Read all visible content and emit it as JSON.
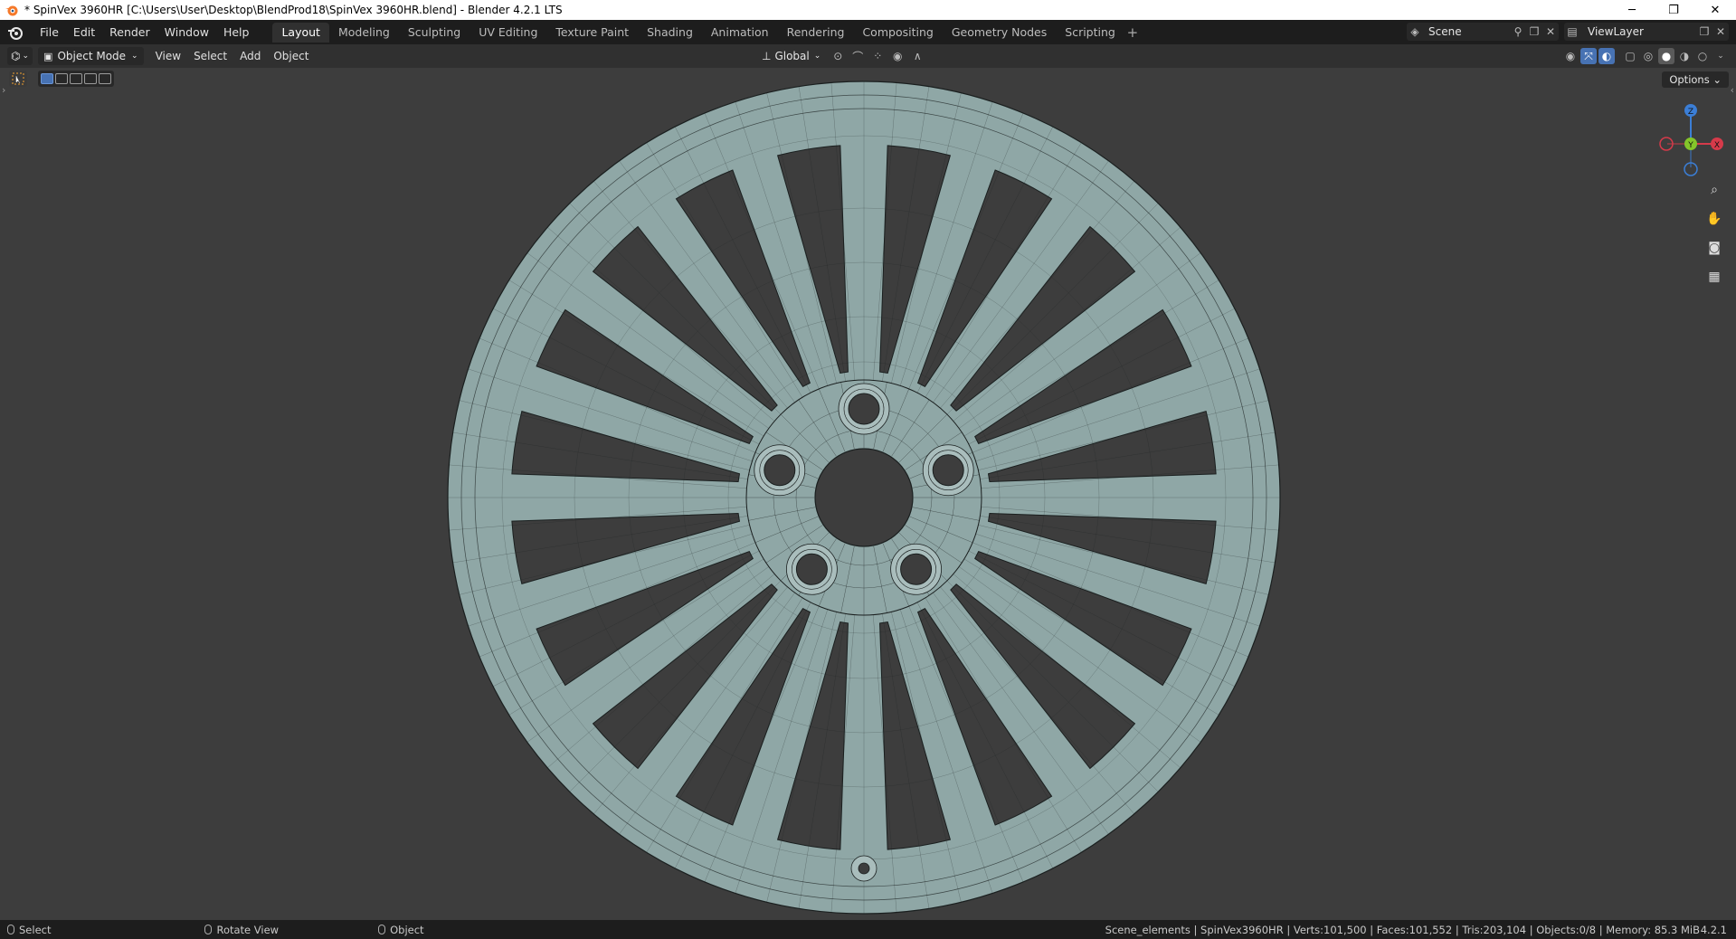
{
  "window": {
    "title": "* SpinVex 3960HR [C:\\Users\\User\\Desktop\\BlendProd18\\SpinVex 3960HR.blend] - Blender 4.2.1 LTS",
    "minimize": "─",
    "maximize": "❐",
    "close": "✕"
  },
  "menu": [
    "File",
    "Edit",
    "Render",
    "Window",
    "Help"
  ],
  "workspaces": {
    "tabs": [
      "Layout",
      "Modeling",
      "Sculpting",
      "UV Editing",
      "Texture Paint",
      "Shading",
      "Animation",
      "Rendering",
      "Compositing",
      "Geometry Nodes",
      "Scripting"
    ],
    "active": "Layout",
    "add": "+"
  },
  "scene": {
    "name": "Scene"
  },
  "view_layer": {
    "name": "ViewLayer"
  },
  "header": {
    "mode": "Object Mode",
    "menus": [
      "View",
      "Select",
      "Add",
      "Object"
    ],
    "transform_orientation": "Global"
  },
  "viewport": {
    "options_label": "Options",
    "axes": {
      "x": "X",
      "y": "Y",
      "z": "Z"
    },
    "colors": {
      "background": "#3d3d3d",
      "mesh": "#8fa7a6",
      "wire": "#1a1f1f",
      "x_axis": "#d63a4a",
      "y_axis": "#84c52a",
      "z_axis": "#3b7ed6"
    }
  },
  "status": {
    "left": [
      {
        "label": "Select",
        "icon": "mouse-left-icon"
      },
      {
        "label": "Rotate View",
        "icon": "mouse-middle-icon"
      },
      {
        "label": "Object",
        "icon": "mouse-right-icon"
      }
    ],
    "stats": "Scene_elements | SpinVex3960HR | Verts:101,500 | Faces:101,552 | Tris:203,104 | Objects:0/8 | Memory: 85.3 MiB",
    "version": "4.2.1"
  }
}
